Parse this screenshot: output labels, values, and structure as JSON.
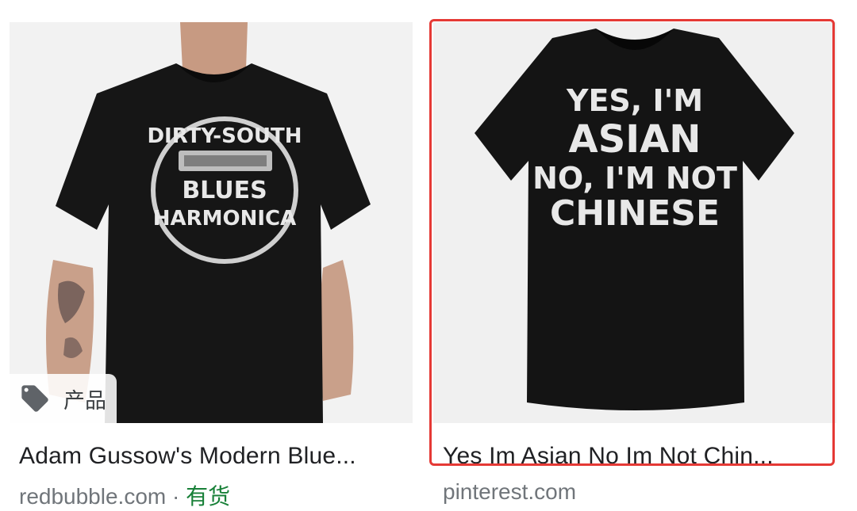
{
  "results": [
    {
      "title": "Adam Gussow's Modern Blue...",
      "source": "redbubble.com",
      "separator": " · ",
      "availability": "有货",
      "badge": {
        "label": "产品",
        "icon": "tag-icon"
      },
      "shirt_print": {
        "line1": "DIRTY-SOUTH",
        "line2": "BLUES",
        "line3": "HARMONICA"
      }
    },
    {
      "title": "Yes Im Asian No Im Not Chin...",
      "source": "pinterest.com",
      "selected": true,
      "shirt_print": {
        "line1": "YES, I'M",
        "line2": "ASIAN",
        "line3": "NO, I'M NOT",
        "line4": "CHINESE"
      }
    }
  ],
  "colors": {
    "selection_border": "#e53935",
    "availability": "#188038",
    "source": "#70757a"
  }
}
